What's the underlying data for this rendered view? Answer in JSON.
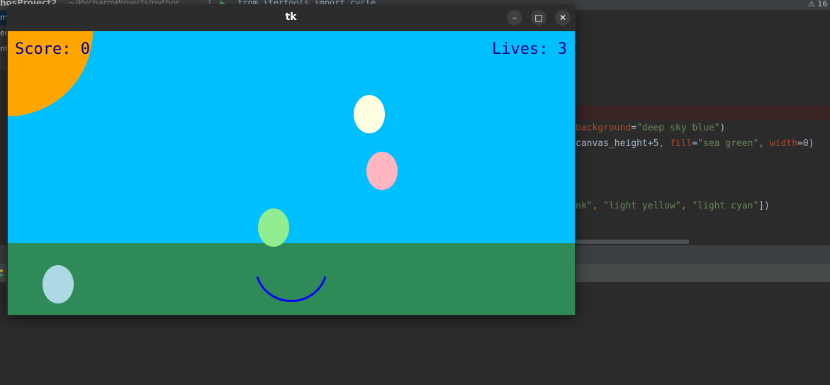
{
  "ide": {
    "project_name": "hosProject2",
    "project_path": "~/PycharmProjects/pythor",
    "line_number": "1",
    "code_top": "from itertools import cycle",
    "warning_count": "16",
    "left_items": [
      "ma",
      "er",
      "nt"
    ],
    "code_lines": [
      {
        "parts": [
          {
            "t": " background",
            "c": "kw"
          },
          {
            "t": "=",
            "c": ""
          },
          {
            "t": "\"deep sky blue\"",
            "c": "str"
          },
          {
            "t": ")",
            "c": ""
          }
        ]
      },
      {
        "parts": [
          {
            "t": "canvas_height+5",
            "c": ""
          },
          {
            "t": ", ",
            "c": "op"
          },
          {
            "t": "fill",
            "c": "kw"
          },
          {
            "t": "=",
            "c": ""
          },
          {
            "t": "\"sea green\"",
            "c": "str"
          },
          {
            "t": ", ",
            "c": "op"
          },
          {
            "t": "width",
            "c": "kw"
          },
          {
            "t": "=0)",
            "c": ""
          }
        ]
      },
      {
        "parts": [
          {
            "t": "nk\"",
            "c": "str"
          },
          {
            "t": ", ",
            "c": "op"
          },
          {
            "t": "\"light yellow\"",
            "c": "str"
          },
          {
            "t": ", ",
            "c": "op"
          },
          {
            "t": "\"light cyan\"",
            "c": "str"
          },
          {
            "t": "])",
            "c": ""
          }
        ]
      }
    ]
  },
  "window": {
    "title": "tk",
    "minimize_icon": "minimize-icon",
    "maximize_icon": "maximize-icon",
    "close_icon": "close-icon",
    "minimize_glyph": "–",
    "maximize_glyph": "□",
    "close_glyph": "✕"
  },
  "game": {
    "score_text": "Score: 0",
    "lives_text": "Lives: 3",
    "colors": {
      "sky": "#00bfff",
      "grass": "#2e8b57",
      "sun": "#ffa500",
      "text": "#00008b",
      "catcher": "#0000ff"
    },
    "eggs": [
      {
        "name": "egg-light-yellow",
        "color": "#ffffe0"
      },
      {
        "name": "egg-pink",
        "color": "#ffb6c1"
      },
      {
        "name": "egg-light-green",
        "color": "#90ee90"
      },
      {
        "name": "egg-light-blue",
        "color": "#add8e6"
      }
    ]
  }
}
